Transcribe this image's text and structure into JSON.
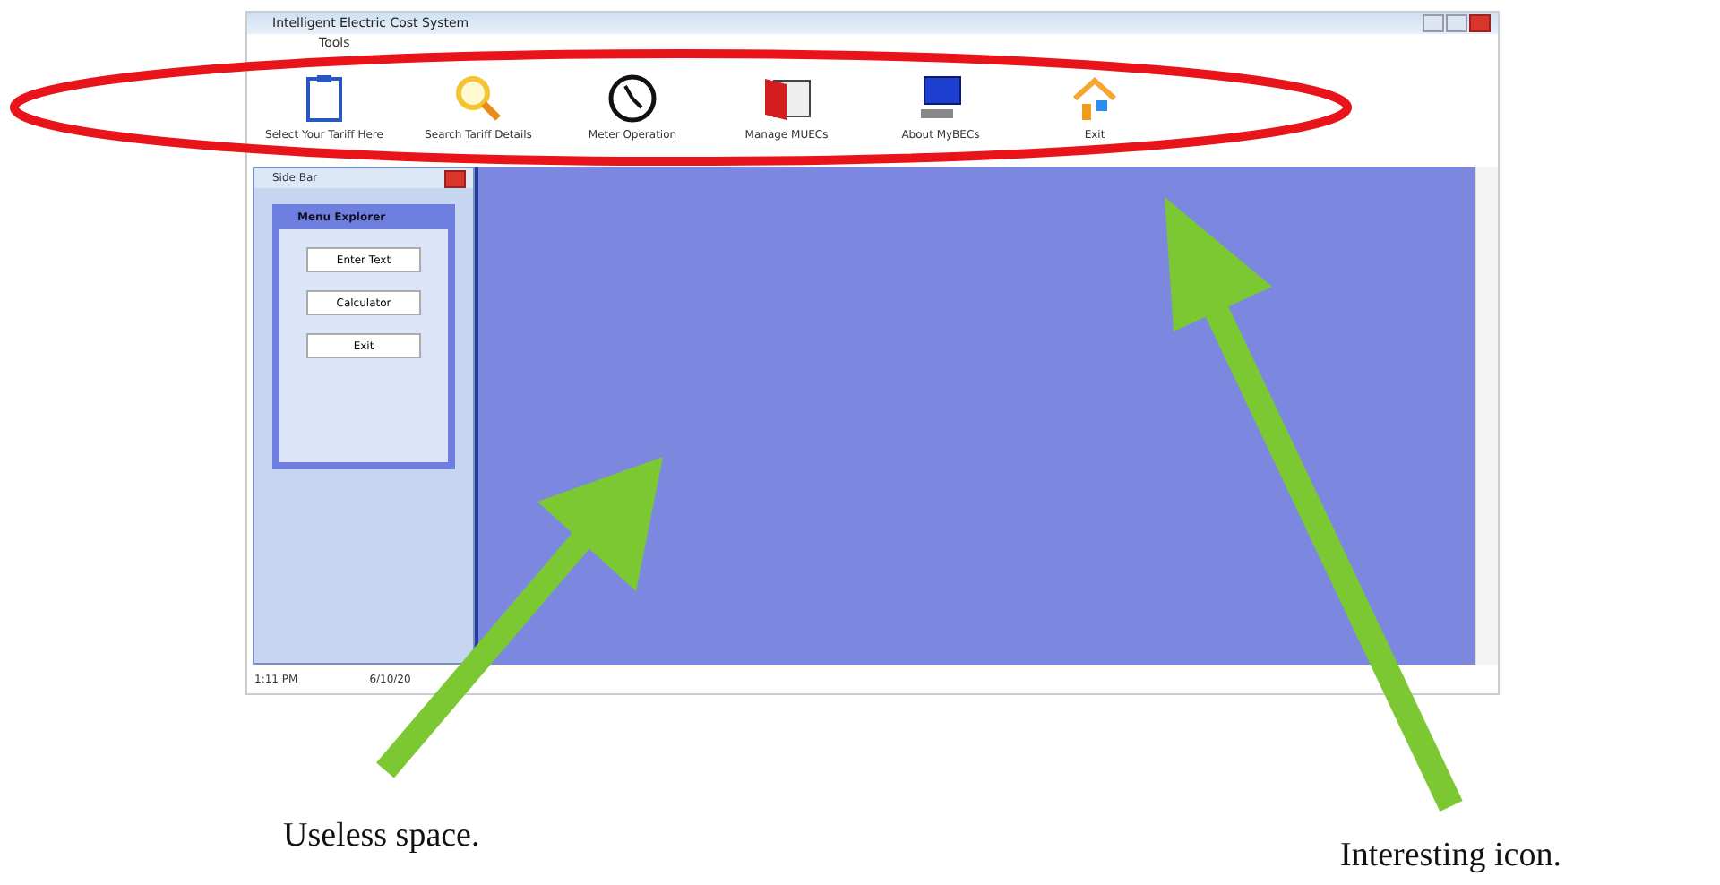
{
  "window": {
    "title": "Intelligent Electric Cost System"
  },
  "menu": [
    "Tools"
  ],
  "toolbar": [
    {
      "label": "Select Your Tariff Here"
    },
    {
      "label": "Search Tariff Details"
    },
    {
      "label": "Meter Operation"
    },
    {
      "label": "Manage MUECs"
    },
    {
      "label": "About MyBECs"
    },
    {
      "label": "Exit"
    }
  ],
  "sidebar": {
    "title": "Side Bar",
    "panel_title": "Menu Explorer",
    "buttons": [
      "Enter Text",
      "Calculator",
      "Exit"
    ]
  },
  "status_bar": [
    "1:11 PM",
    "6/10/20"
  ],
  "annotations": [
    {
      "text": "Useless space."
    },
    {
      "text": "Interesting icon."
    }
  ]
}
